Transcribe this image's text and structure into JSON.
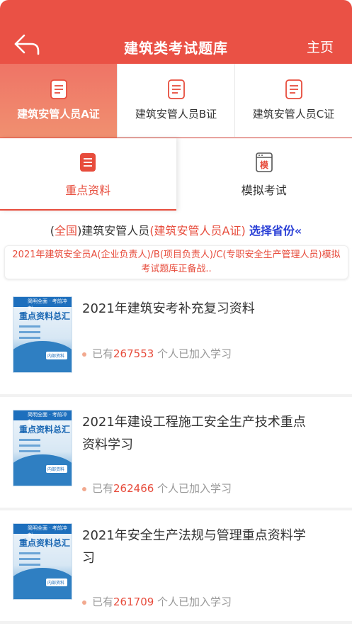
{
  "header": {
    "title": "建筑类考试题库",
    "home_label": "主页"
  },
  "cert_tabs": [
    {
      "label": "建筑安管人员A证",
      "active": true
    },
    {
      "label": "建筑安管人员B证",
      "active": false
    },
    {
      "label": "建筑安管人员C证",
      "active": false
    }
  ],
  "mode_tabs": [
    {
      "label": "重点资料",
      "active": true
    },
    {
      "label": "模拟考试",
      "active": false,
      "icon_text": "模"
    }
  ],
  "region": {
    "part1": "(",
    "region_name": "全国",
    "part2": ")建筑安管人员",
    "cert": "(建筑安管人员A证)",
    "link": "选择省份«"
  },
  "notice": "2021年建筑安全员A(企业负责人)/B(项目负责人)/C(专职安全生产管理人员)模拟考试题库正备战..",
  "cover": {
    "title": "重点资料总汇",
    "band_text": "简明全面 · 考前冲刺",
    "stamp": "内部资料"
  },
  "items": [
    {
      "title": "2021年建筑安考补充复习资料",
      "prefix": "已有",
      "count": "267553",
      "suffix": " 个人已加入学习"
    },
    {
      "title": "2021年建设工程施工安全生产技术重点资料学习",
      "prefix": "已有",
      "count": "262466",
      "suffix": " 个人已加入学习"
    },
    {
      "title": "2021年安全生产法规与管理重点资料学习",
      "prefix": "已有",
      "count": "261709",
      "suffix": " 个人已加入学习"
    }
  ],
  "colors": {
    "brand": "#ea5145",
    "link": "#2a3fd6"
  }
}
